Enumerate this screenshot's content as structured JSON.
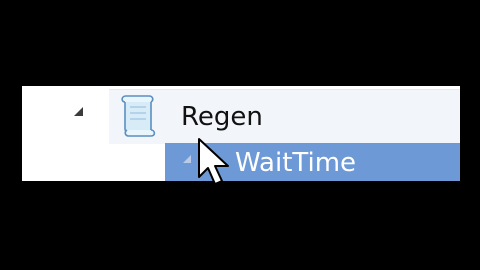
{
  "tree": {
    "parent_node": {
      "label": "Regen",
      "icon": "scroll-icon",
      "expanded": true
    },
    "child_node": {
      "label": "WaitTime",
      "selected": true
    }
  },
  "colors": {
    "letterbox": "#000000",
    "panel_background": "#ffffff",
    "selection_highlight": "#6d9ad7"
  }
}
